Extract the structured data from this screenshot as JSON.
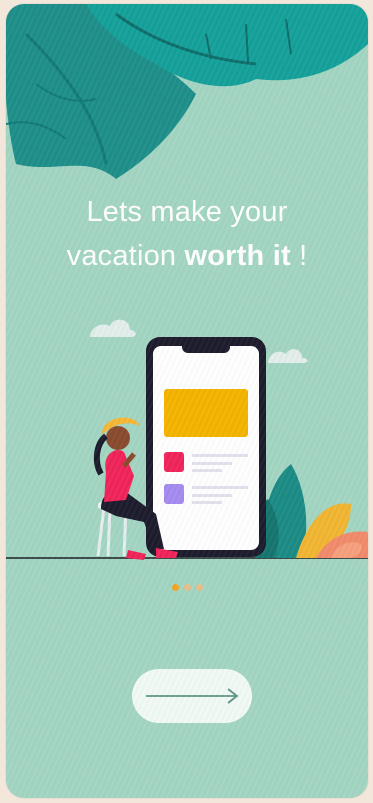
{
  "onboarding": {
    "headline_line1": "Lets make your",
    "headline_line2_prefix": "vacation",
    "headline_line2_bold": "worth it",
    "headline_line2_suffix": "!"
  },
  "pagination": {
    "total": 3,
    "current": 1
  },
  "next_button": {
    "icon": "arrow-right-icon"
  },
  "colors": {
    "background": "#a3d6c3",
    "leaf_dark": "#1f8f8a",
    "accent": "#f5a623",
    "phone_frame": "#1c1c2e"
  }
}
